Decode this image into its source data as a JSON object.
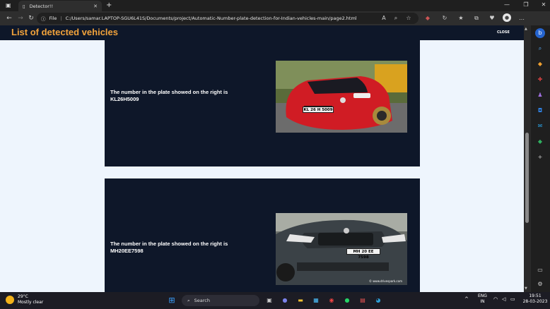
{
  "browser": {
    "tab_title": "Detector!!",
    "url_prefix": "File",
    "url": "C:/Users/samar.LAPTOP-SGU6L41S/Documents/project/Automatic-Number-plate-detection-for-Indian-vehicles-main/page2.html"
  },
  "page": {
    "title": "List of detected vehicles",
    "close_label": "CLOSE",
    "cards": [
      {
        "text": "The number in the plate showed on the right is",
        "plate": "KL26H5009",
        "photo_plate": "KL 26 H 5009"
      },
      {
        "text": "The number in the plate showed on the right is",
        "plate": "MH20EE7598",
        "photo_plate": "MH 20 EE 7598",
        "photo_credit": "© www.drivespark.com"
      }
    ]
  },
  "taskbar": {
    "temperature": "29°C",
    "weather": "Mostly clear",
    "search_label": "Search",
    "lang_top": "ENG",
    "lang_bottom": "IN",
    "time": "19:51",
    "date": "28-03-2023"
  },
  "colors": {
    "header_bg": "#0e1729",
    "title_color": "#f1a23b",
    "page_bg": "#eef5fd"
  }
}
